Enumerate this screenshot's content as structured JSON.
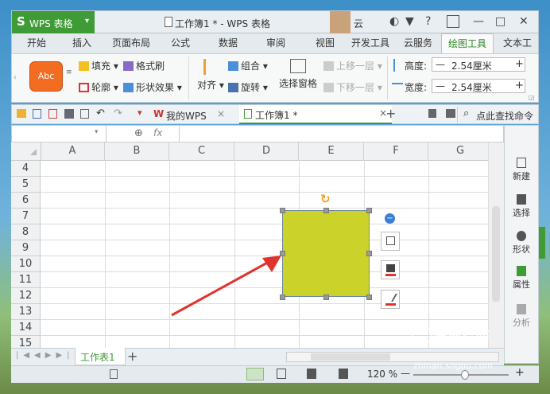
{
  "app": {
    "logo": "S",
    "name": "WPS 表格",
    "menu_icon": "chevron-down-icon"
  },
  "title": {
    "text": "工作簿1 * - WPS 表格",
    "user": "云"
  },
  "window_controls": {
    "minimize": "—",
    "maximize": "□",
    "close": "✕",
    "help": "?"
  },
  "tabs": [
    "开始",
    "插入",
    "页面布局",
    "公式",
    "数据",
    "审阅",
    "视图",
    "开发工具",
    "云服务",
    "绘图工具",
    "文本工"
  ],
  "active_tab": "绘图工具",
  "ribbon": {
    "style_preview": "Abc",
    "fill": "填充",
    "format_brush": "格式刷",
    "outline": "轮廓",
    "shape_effect": "形状效果",
    "align": "对齐",
    "group": "组合",
    "rotate": "旋转",
    "selection_pane": "选择窗格",
    "bring_forward": "上移一层",
    "send_backward": "下移一层",
    "height_label": "高度:",
    "height_value": "2.54厘米",
    "width_label": "宽度:",
    "width_value": "2.54厘米",
    "minus": "—",
    "plus": "+"
  },
  "quickbar": {
    "my_wps": "我的WPS",
    "doc_tab": "工作簿1 *",
    "search": "点此查找命令",
    "close": "×",
    "add": "+"
  },
  "formula_bar": {
    "fx": "fx"
  },
  "columns": [
    "A",
    "B",
    "C",
    "D",
    "E",
    "F",
    "G"
  ],
  "rows": [
    "4",
    "5",
    "6",
    "7",
    "8",
    "9",
    "10",
    "11",
    "12",
    "13",
    "14",
    "15"
  ],
  "right_panel": [
    "新建",
    "选择",
    "形状",
    "属性",
    "分析"
  ],
  "sheet_tab": "工作表1",
  "add_sheet": "+",
  "status": {
    "zoom": "120 %",
    "minus": "—",
    "plus": "+"
  },
  "watermark": {
    "text": "搜狗指南",
    "url": "zhinan.sogou.com"
  },
  "colors": {
    "accent": "#3f9b36",
    "shape": "#cbd32a",
    "abc": "#f26d21",
    "arrow": "#e0332d"
  }
}
